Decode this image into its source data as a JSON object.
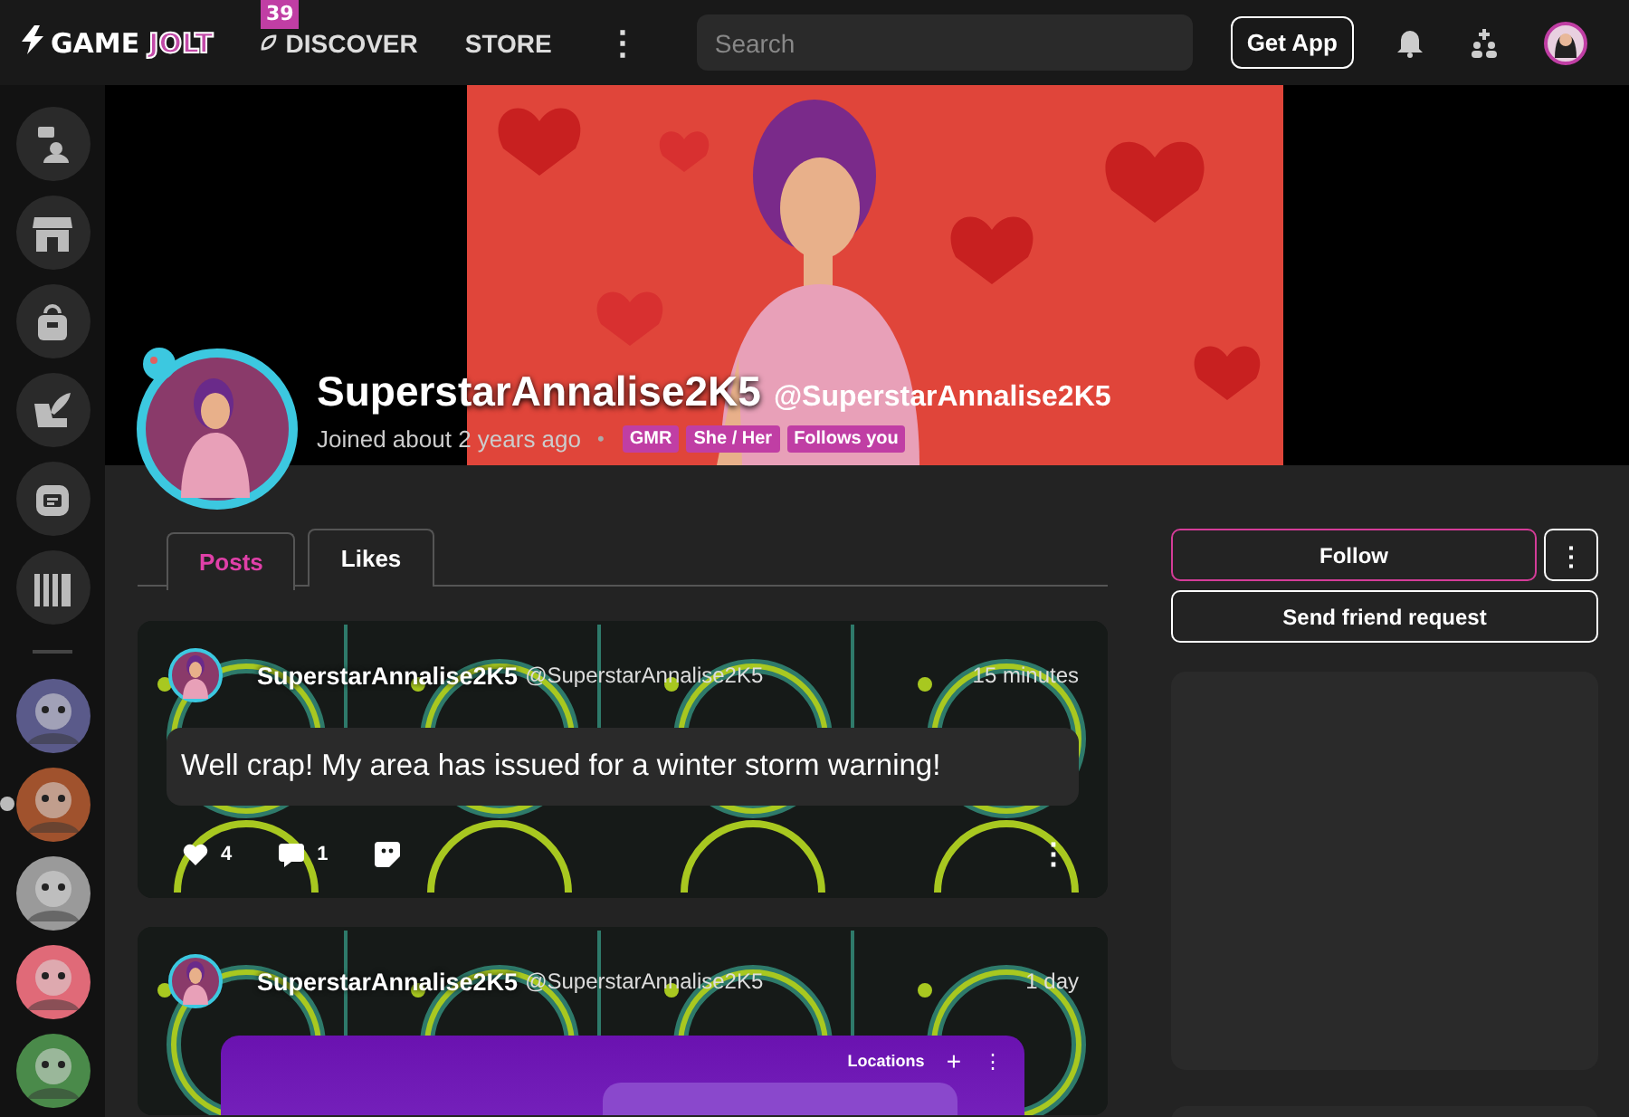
{
  "topbar": {
    "logo": {
      "word_1": "GAME",
      "word_2": "JOLT"
    },
    "badge": "39",
    "nav": [
      {
        "label": "DISCOVER",
        "kind": "icon"
      },
      {
        "label": "STORE",
        "kind": "plain"
      }
    ],
    "more": "⋮",
    "search": {
      "placeholder": "Search"
    },
    "get_app": "Get App"
  },
  "sidebar": {
    "buttons": [
      {
        "kind": "chat"
      },
      {
        "kind": "store"
      },
      {
        "kind": "bag"
      },
      {
        "kind": "quill"
      },
      {
        "kind": "robot"
      },
      {
        "kind": "library"
      }
    ],
    "communities": [
      {
        "selected": false,
        "color": "#5a5a8a"
      },
      {
        "selected": true,
        "color": "#a0522d"
      },
      {
        "selected": false,
        "color": "#9a9a9a"
      },
      {
        "selected": false,
        "color": "#e06a78"
      },
      {
        "selected": false,
        "color": "#4a8a4a"
      }
    ]
  },
  "profile": {
    "name": "SuperstarAnnalise2K5",
    "handle": "@SuperstarAnnalise2K5",
    "joined": "Joined about 2 years ago",
    "separator": "•",
    "tags": [
      "GMR",
      "She / Her",
      "Follows you"
    ]
  },
  "tabs": [
    {
      "label": "Posts",
      "selected": true
    },
    {
      "label": "Likes",
      "selected": false
    }
  ],
  "posts": [
    {
      "author": "SuperstarAnnalise2K5",
      "handle": "@SuperstarAnnalise2K5",
      "time": "15 minutes",
      "text": "Well crap! My area has issued for a winter storm warning!",
      "likes": "4",
      "comments": "1",
      "more": "⋮"
    },
    {
      "author": "SuperstarAnnalise2K5",
      "handle": "@SuperstarAnnalise2K5",
      "time": "1 day",
      "embed": {
        "label": "Locations",
        "add": "+",
        "more": "⋮"
      }
    }
  ],
  "actions": {
    "follow": "Follow",
    "more": "⋮",
    "friend_request": "Send friend request"
  }
}
